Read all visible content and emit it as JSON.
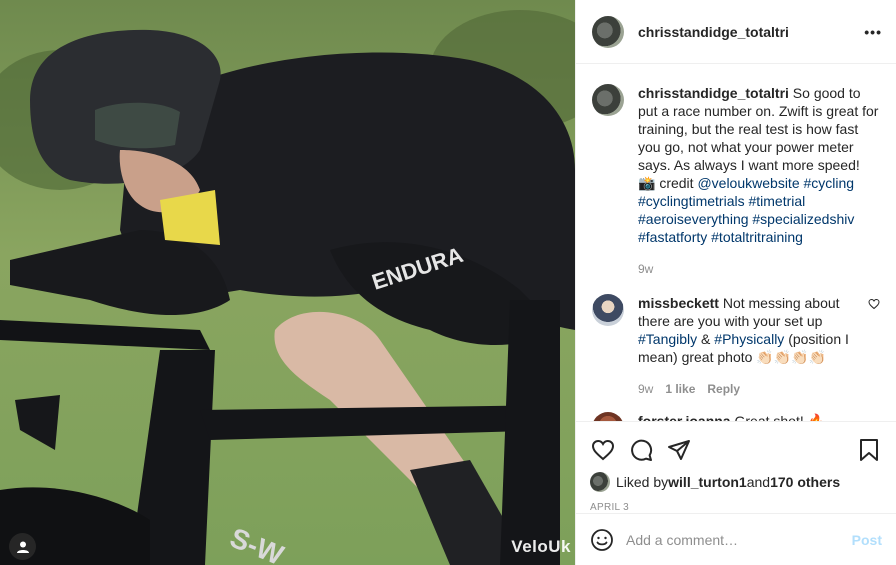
{
  "photo": {
    "watermark": "VeloUk",
    "jersey_text": "ENDURA",
    "frame_text": "S-W"
  },
  "header": {
    "username": "chrisstandidge_totaltri",
    "more_icon": "more-horizontal-icon"
  },
  "caption": {
    "username": "chrisstandidge_totaltri",
    "text_before": " So good to put a race number on. Zwift is great for training, but the real test is how fast you go, not what your power meter says. As always I want more speed! 📸 credit ",
    "mention": "@veloukwebsite",
    "tags": "#cycling #cyclingtimetrials #timetrial #aeroiseverything #specializedshiv #fastatforty #totaltritraining",
    "age": "9w"
  },
  "comments": [
    {
      "username": "missbeckett",
      "text_before": " Not messing about there are you with your set up ",
      "tag1": "#Tangibly",
      "text_mid": " & ",
      "tag2": "#Physically",
      "text_after": " (position I mean) great photo 👏🏻👏🏻👏🏻👏🏻",
      "age": "9w",
      "likes": "1 like",
      "reply": "Reply"
    },
    {
      "username": "forster.joanna",
      "text": " Great shot! 🔥"
    }
  ],
  "likes": {
    "prefix": "Liked by ",
    "user": "will_turton1",
    "middle": " and ",
    "others": "170 others"
  },
  "date": "APRIL 3",
  "add_comment": {
    "placeholder": "Add a comment…",
    "post": "Post"
  },
  "colors": {
    "link": "#00376b",
    "muted": "#8e8e8e",
    "post_disabled": "#b2dffc"
  }
}
